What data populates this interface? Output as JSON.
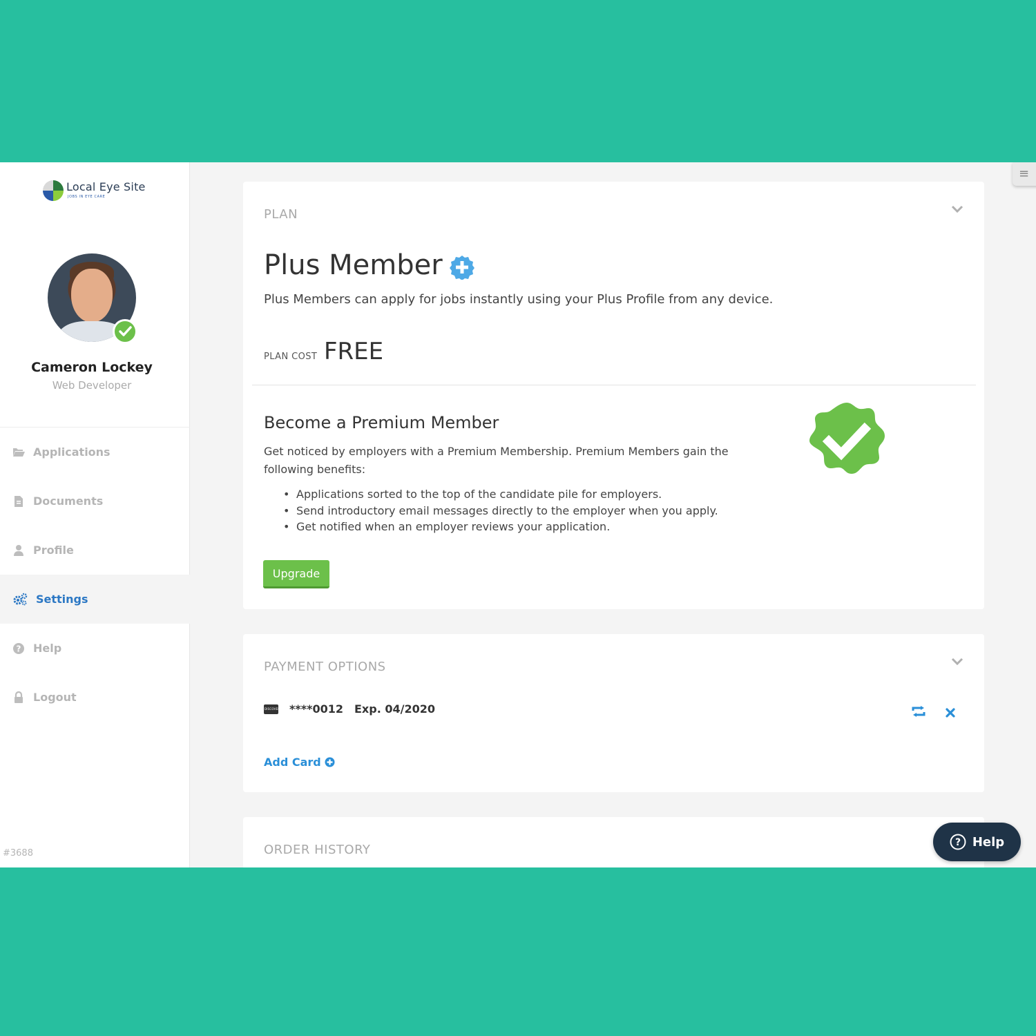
{
  "brand": {
    "name": "Local Eye Site",
    "tagline": "JOBS IN EYE CARE"
  },
  "user": {
    "name": "Cameron Lockey",
    "role": "Web Developer"
  },
  "sidebar": {
    "items": [
      {
        "label": "Applications",
        "icon": "folder-open-icon"
      },
      {
        "label": "Documents",
        "icon": "document-icon"
      },
      {
        "label": "Profile",
        "icon": "user-icon"
      },
      {
        "label": "Settings",
        "icon": "gears-icon",
        "active": true
      },
      {
        "label": "Help",
        "icon": "question-circle-icon"
      },
      {
        "label": "Logout",
        "icon": "lock-icon"
      }
    ],
    "build_id": "#3688"
  },
  "plan": {
    "section_label": "PLAN",
    "title": "Plus Member",
    "description": "Plus Members can apply for jobs instantly using your Plus Profile from any device.",
    "cost_label": "PLAN COST",
    "cost_value": "FREE",
    "premium": {
      "title": "Become a Premium Member",
      "description": "Get noticed by employers with a Premium Membership. Premium Members gain the following benefits:",
      "benefits": [
        "Applications sorted to the top of the candidate pile for employers.",
        "Send introductory email messages directly to the employer when you apply.",
        "Get notified when an employer reviews your application."
      ],
      "upgrade_label": "Upgrade"
    }
  },
  "payment": {
    "section_label": "PAYMENT OPTIONS",
    "card": {
      "brand": "DISCOVER",
      "number": "****0012",
      "expiry": "Exp. 04/2020"
    },
    "add_card_label": "Add Card"
  },
  "orders": {
    "section_label": "ORDER HISTORY"
  },
  "help_button": {
    "label": "Help"
  },
  "colors": {
    "background": "#27bf9f",
    "accent_blue": "#2c78c4",
    "link_blue": "#2a8fd8",
    "success_green": "#6cc04a",
    "help_dark": "#1f3347"
  }
}
